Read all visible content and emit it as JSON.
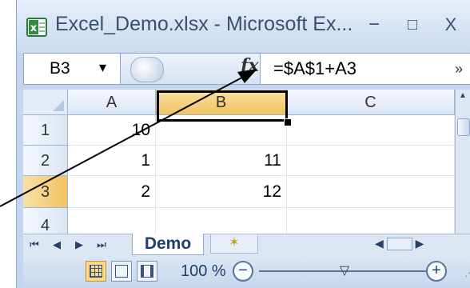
{
  "window": {
    "title": "Excel_Demo.xlsx - Microsoft Ex...",
    "app_icon": "excel-icon",
    "minimize": "−",
    "maximize": "□",
    "close": "X"
  },
  "formula_bar": {
    "name_box": "B3",
    "name_box_dropdown": "▾",
    "fx_label": "fx",
    "formula": "=$A$1+A3",
    "expand": "»"
  },
  "grid": {
    "columns": [
      "A",
      "B",
      "C"
    ],
    "rows": [
      {
        "header": "1",
        "A": "10",
        "B": ""
      },
      {
        "header": "2",
        "A": "1",
        "B": "11"
      },
      {
        "header": "3",
        "A": "2",
        "B": "12"
      },
      {
        "header": "4",
        "A": "",
        "B": ""
      }
    ],
    "active_cell": "B3"
  },
  "sheet_tabs": {
    "nav": [
      "⏮",
      "◀",
      "▶",
      "⏭"
    ],
    "active_tab": "Demo",
    "new_tab_icon": "insert-sheet-icon"
  },
  "status_bar": {
    "zoom_label": "100 %",
    "zoom_out": "−",
    "zoom_in": "+",
    "zoom_level_percent": 100
  },
  "colors": {
    "selected_header": "#f1c35f",
    "window_frame": "#c4d6ee",
    "tab_text": "#1e3e6e"
  }
}
